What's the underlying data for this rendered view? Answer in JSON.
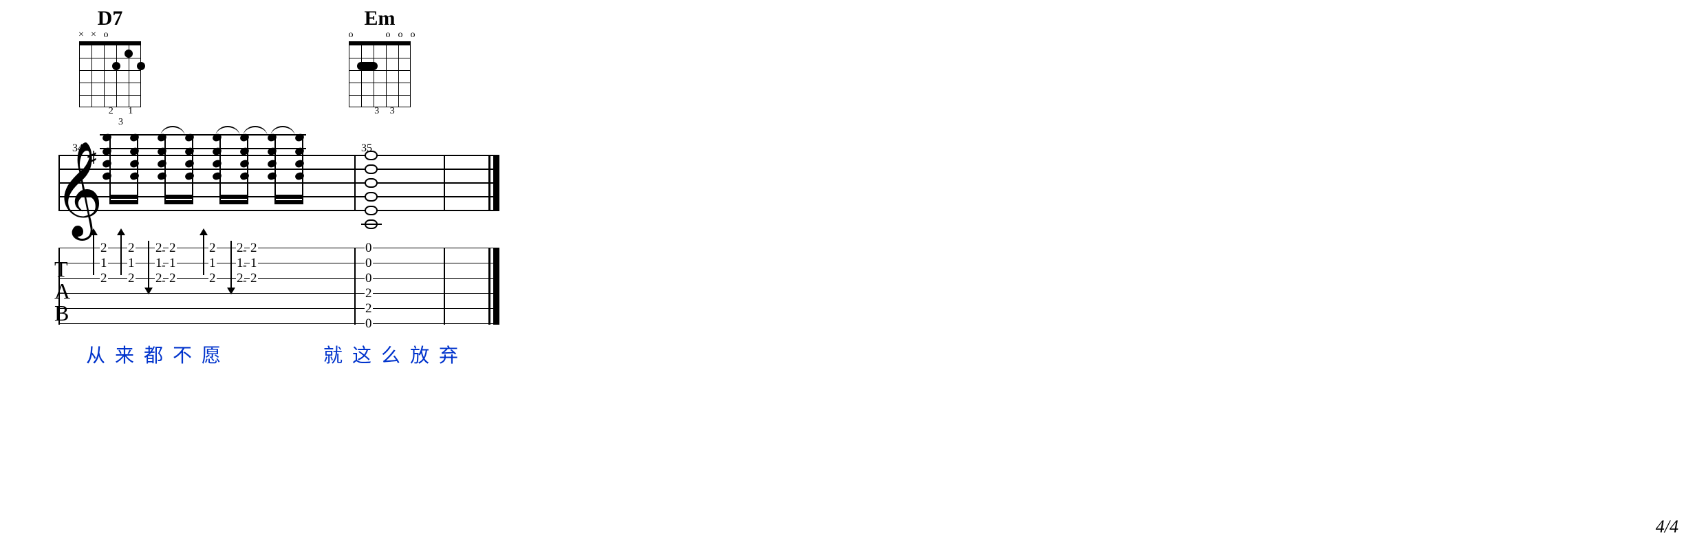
{
  "chords": {
    "d7": {
      "name": "D7",
      "fingering_label": "2 1 3"
    },
    "em": {
      "name": "Em",
      "fingering_label": "3 3"
    }
  },
  "measures": {
    "m1": "34",
    "m2": "35"
  },
  "tab_label": {
    "t": "T",
    "a": "A",
    "b": "B"
  },
  "tab_numbers": {
    "d7_e": "2",
    "d7_b": "1",
    "d7_g": "2",
    "em_e": "0",
    "em_b": "0",
    "em_g": "0",
    "em_d": "2",
    "em_a": "2",
    "em_E": "0"
  },
  "lyrics": {
    "line1": "从来都不愿",
    "line2": "就这么放弃"
  },
  "page": "4/4",
  "chart_data": {
    "type": "table",
    "description": "Guitar tablature/notation, measures 34-35",
    "chords": [
      {
        "name": "D7",
        "diagram": {
          "open": [
            4
          ],
          "muted": [
            6,
            5
          ],
          "dots": [
            {
              "string": 3,
              "fret": 2
            },
            {
              "string": 2,
              "fret": 1
            },
            {
              "string": 1,
              "fret": 2
            }
          ],
          "fingers": "213"
        }
      },
      {
        "name": "Em",
        "diagram": {
          "open": [
            6,
            3,
            2,
            1
          ],
          "barre": {
            "fret": 2,
            "from": 5,
            "to": 4
          },
          "fingers": "33"
        }
      }
    ],
    "measures": [
      {
        "number": 34,
        "chord": "D7",
        "strums": [
          {
            "dir": "up",
            "frets_high_to_low": [
              2,
              1,
              2
            ]
          },
          {
            "dir": "up",
            "frets_high_to_low": [
              2,
              1,
              2
            ]
          },
          {
            "dir": "down",
            "frets_high_to_low": [
              2,
              1,
              2
            ]
          },
          {
            "dir": "tie",
            "frets_high_to_low": [
              2,
              1,
              2
            ]
          },
          {
            "dir": "up",
            "frets_high_to_low": [
              2,
              1,
              2
            ]
          },
          {
            "dir": "down",
            "frets_high_to_low": [
              2,
              1,
              2
            ]
          },
          {
            "dir": "tie",
            "frets_high_to_low": [
              2,
              1,
              2
            ]
          }
        ],
        "lyrics": "从来都不愿"
      },
      {
        "number": 35,
        "chord": "Em",
        "notes_whole_chord_low_to_high": [
          0,
          2,
          2,
          0,
          0,
          0
        ],
        "lyrics": "就这么放弃"
      }
    ]
  }
}
